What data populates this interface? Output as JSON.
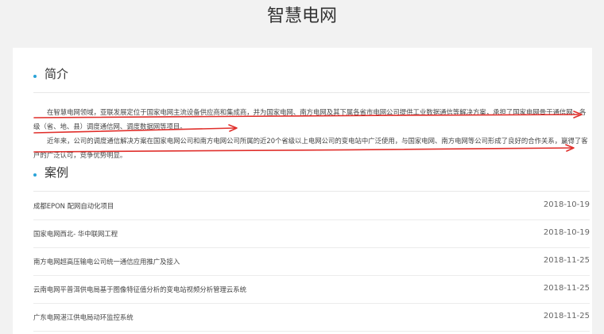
{
  "page": {
    "title": "智慧电网"
  },
  "intro_section": {
    "heading": "简介",
    "paragraphs": [
      "在智慧电网领域，亚联发展定位于国家电网主流设备供应商和集成商，并为国家电网、南方电网及其下属各省市电网公司提供工业数据通信等解决方案，承担了国家电网骨干通信网、各级（省、地、县）调度通信网、调度数据网等项目。",
      "近年来，公司的调度通信解决方案在国家电网公司和南方电网公司所属的近20个省级以上电网公司的变电站中广泛使用，与国家电网、南方电网等公司形成了良好的合作关系，赢得了客户的广泛认可，竞争优势明显。"
    ]
  },
  "cases_section": {
    "heading": "案例",
    "items": [
      {
        "name": "成都EPON 配网自动化项目",
        "date": "2018-10-19"
      },
      {
        "name": "国家电网西北- 华中联网工程",
        "date": "2018-10-19"
      },
      {
        "name": "南方电网超高压输电公司统一通信应用推广及接入",
        "date": "2018-11-25"
      },
      {
        "name": "云南电网平普洱供电局基于图像特征值分析的变电站视频分析管理云系统",
        "date": "2018-11-25"
      },
      {
        "name": "广东电网湛江供电局动环监控系统",
        "date": "2018-11-25"
      }
    ]
  },
  "colors": {
    "accent_dot": "#2aa3d8",
    "annotation_red": "#e0302c"
  }
}
